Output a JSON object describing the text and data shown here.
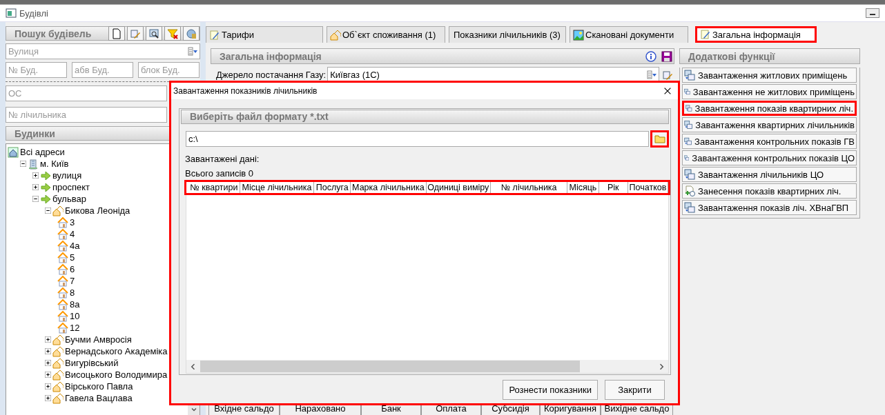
{
  "window": {
    "title": "Будівлі"
  },
  "search_panel": {
    "title": "Пошук будівель",
    "street": {
      "placeholder": "Вулиця"
    },
    "fields": [
      {
        "placeholder": "№ Буд."
      },
      {
        "placeholder": "абв Буд."
      },
      {
        "placeholder": "блок Буд."
      }
    ],
    "os": {
      "placeholder": "ОС"
    },
    "meter": {
      "placeholder": "№ лічильника"
    }
  },
  "buildings": {
    "title": "Будинки",
    "tree": [
      {
        "label": "Всі адреси",
        "kind": "root",
        "children": [
          {
            "label": "м. Київ",
            "kind": "city",
            "expanded": true,
            "children": [
              {
                "label": "вулиця",
                "kind": "category",
                "expanded": false
              },
              {
                "label": "проспект",
                "kind": "category",
                "expanded": false
              },
              {
                "label": "бульвар",
                "kind": "category",
                "expanded": true,
                "children": [
                  {
                    "label": "Бикова Леоніда",
                    "kind": "street",
                    "expanded": true,
                    "children": [
                      {
                        "label": "3",
                        "kind": "house"
                      },
                      {
                        "label": "4",
                        "kind": "house"
                      },
                      {
                        "label": "4а",
                        "kind": "house"
                      },
                      {
                        "label": "5",
                        "kind": "house"
                      },
                      {
                        "label": "6",
                        "kind": "house"
                      },
                      {
                        "label": "7",
                        "kind": "house"
                      },
                      {
                        "label": "8",
                        "kind": "house"
                      },
                      {
                        "label": "8а",
                        "kind": "house"
                      },
                      {
                        "label": "10",
                        "kind": "house"
                      },
                      {
                        "label": "12",
                        "kind": "house"
                      }
                    ]
                  },
                  {
                    "label": "Бучми Амвросія",
                    "kind": "street",
                    "expanded": false
                  },
                  {
                    "label": "Вернадського Академіка",
                    "kind": "street",
                    "expanded": false
                  },
                  {
                    "label": "Вигурівський",
                    "kind": "street",
                    "expanded": false
                  },
                  {
                    "label": "Висоцького Володимира",
                    "kind": "street",
                    "expanded": false
                  },
                  {
                    "label": "Вірського Павла",
                    "kind": "street",
                    "expanded": false
                  },
                  {
                    "label": "Гавела Вацлава",
                    "kind": "street",
                    "expanded": false
                  }
                ]
              }
            ]
          }
        ]
      }
    ]
  },
  "tabs": [
    {
      "label": "Тарифи",
      "kind": "tariff",
      "selected": false,
      "highlighted": false
    },
    {
      "label": "Об`єкт споживання (1)",
      "kind": "object",
      "selected": false,
      "highlighted": false
    },
    {
      "label": "Показники лічильників (3)",
      "kind": "meter",
      "selected": false,
      "highlighted": false
    },
    {
      "label": "Скановані документи",
      "kind": "scan",
      "selected": false,
      "highlighted": false
    },
    {
      "label": "Загальна інформація",
      "kind": "tariff",
      "selected": true,
      "highlighted": true
    }
  ],
  "info_panel": {
    "title": "Загальна інформація",
    "source_label": "Джерело постачання Газу:",
    "source_value": "Київгаз (1С)"
  },
  "functions": {
    "title": "Додаткові функції",
    "items": [
      {
        "label": "Завантаження житлових приміщень",
        "kind": "upload",
        "highlighted": false
      },
      {
        "label": "Завантаження не житлових приміщень",
        "kind": "upload",
        "highlighted": false
      },
      {
        "label": "Завантаження показів квартирних ліч.",
        "kind": "upload",
        "highlighted": true
      },
      {
        "label": "Завантаження квартирних лічильників",
        "kind": "upload",
        "highlighted": false
      },
      {
        "label": "Завантаження контрольних показів ГВ",
        "kind": "upload",
        "highlighted": false
      },
      {
        "label": "Завантаження контрольних показів ЦО",
        "kind": "upload",
        "highlighted": false
      },
      {
        "label": "Завантаження лічильників ЦО",
        "kind": "upload",
        "highlighted": false
      },
      {
        "label": "Занесення показів квартирних ліч.",
        "kind": "entry",
        "highlighted": false
      },
      {
        "label": "Завантаження показів ліч. ХВнаГВП",
        "kind": "upload",
        "highlighted": false
      }
    ]
  },
  "bottom_columns": [
    "Вхідне сальдо",
    "Нараховано",
    "Банк",
    "Оплата",
    "Субсидія",
    "Коригування",
    "Вихідне сальдо"
  ],
  "dialog": {
    "title": "Завантаження показників лічильників",
    "highlighted": true,
    "group_title": "Виберіть файл формату *.txt",
    "path": "c:\\",
    "browse_highlighted": true,
    "loaded_label": "Завантажені дані:",
    "total_label": "Всього записів 0",
    "header_highlighted": true,
    "columns": [
      "№ квартири",
      "Місце лічильника",
      "Послуга",
      "Марка лічильника",
      "Одиниці виміру",
      "№ лічильника",
      "Місяць",
      "Рік",
      "Початков"
    ],
    "buttons": [
      "Рознести показники",
      "Закрити"
    ]
  }
}
